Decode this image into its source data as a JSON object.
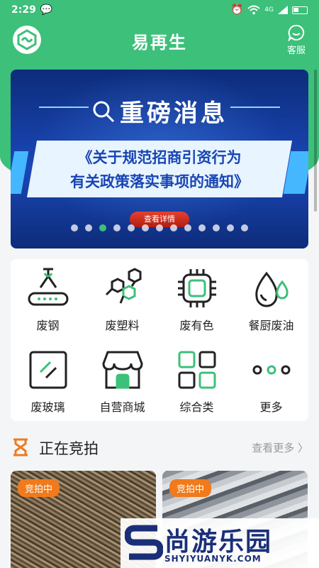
{
  "status_bar": {
    "time": "2:29",
    "network": "4G"
  },
  "header": {
    "app_title": "易再生",
    "service_label": "客服"
  },
  "banner": {
    "headline": "重磅消息",
    "subtitle_line1": "《关于规范招商引资行为",
    "subtitle_line2": "有关政策落实事项的通知》",
    "button_label": "查看详情",
    "dot_count": 13,
    "active_dot": 3
  },
  "categories": [
    {
      "label": "废钢",
      "icon": "crane-hook-icon"
    },
    {
      "label": "废塑料",
      "icon": "molecule-icon"
    },
    {
      "label": "废有色",
      "icon": "chip-icon"
    },
    {
      "label": "餐厨废油",
      "icon": "oil-drops-icon"
    },
    {
      "label": "废玻璃",
      "icon": "glass-pane-icon"
    },
    {
      "label": "自营商城",
      "icon": "store-icon"
    },
    {
      "label": "综合类",
      "icon": "grid-icon"
    },
    {
      "label": "更多",
      "icon": "more-dots-icon"
    }
  ],
  "auction": {
    "title": "正在竞拍",
    "see_more": "查看更多 〉",
    "items": [
      {
        "tag": "竞拍中"
      },
      {
        "tag": "竞拍中"
      }
    ]
  },
  "watermark": {
    "text": "尚游乐园",
    "url": "SHYIYUANYK.COM"
  },
  "colors": {
    "brand_green": "#3cc07a",
    "tag_orange": "#f07a1c",
    "banner_blue": "#1a47b8"
  }
}
